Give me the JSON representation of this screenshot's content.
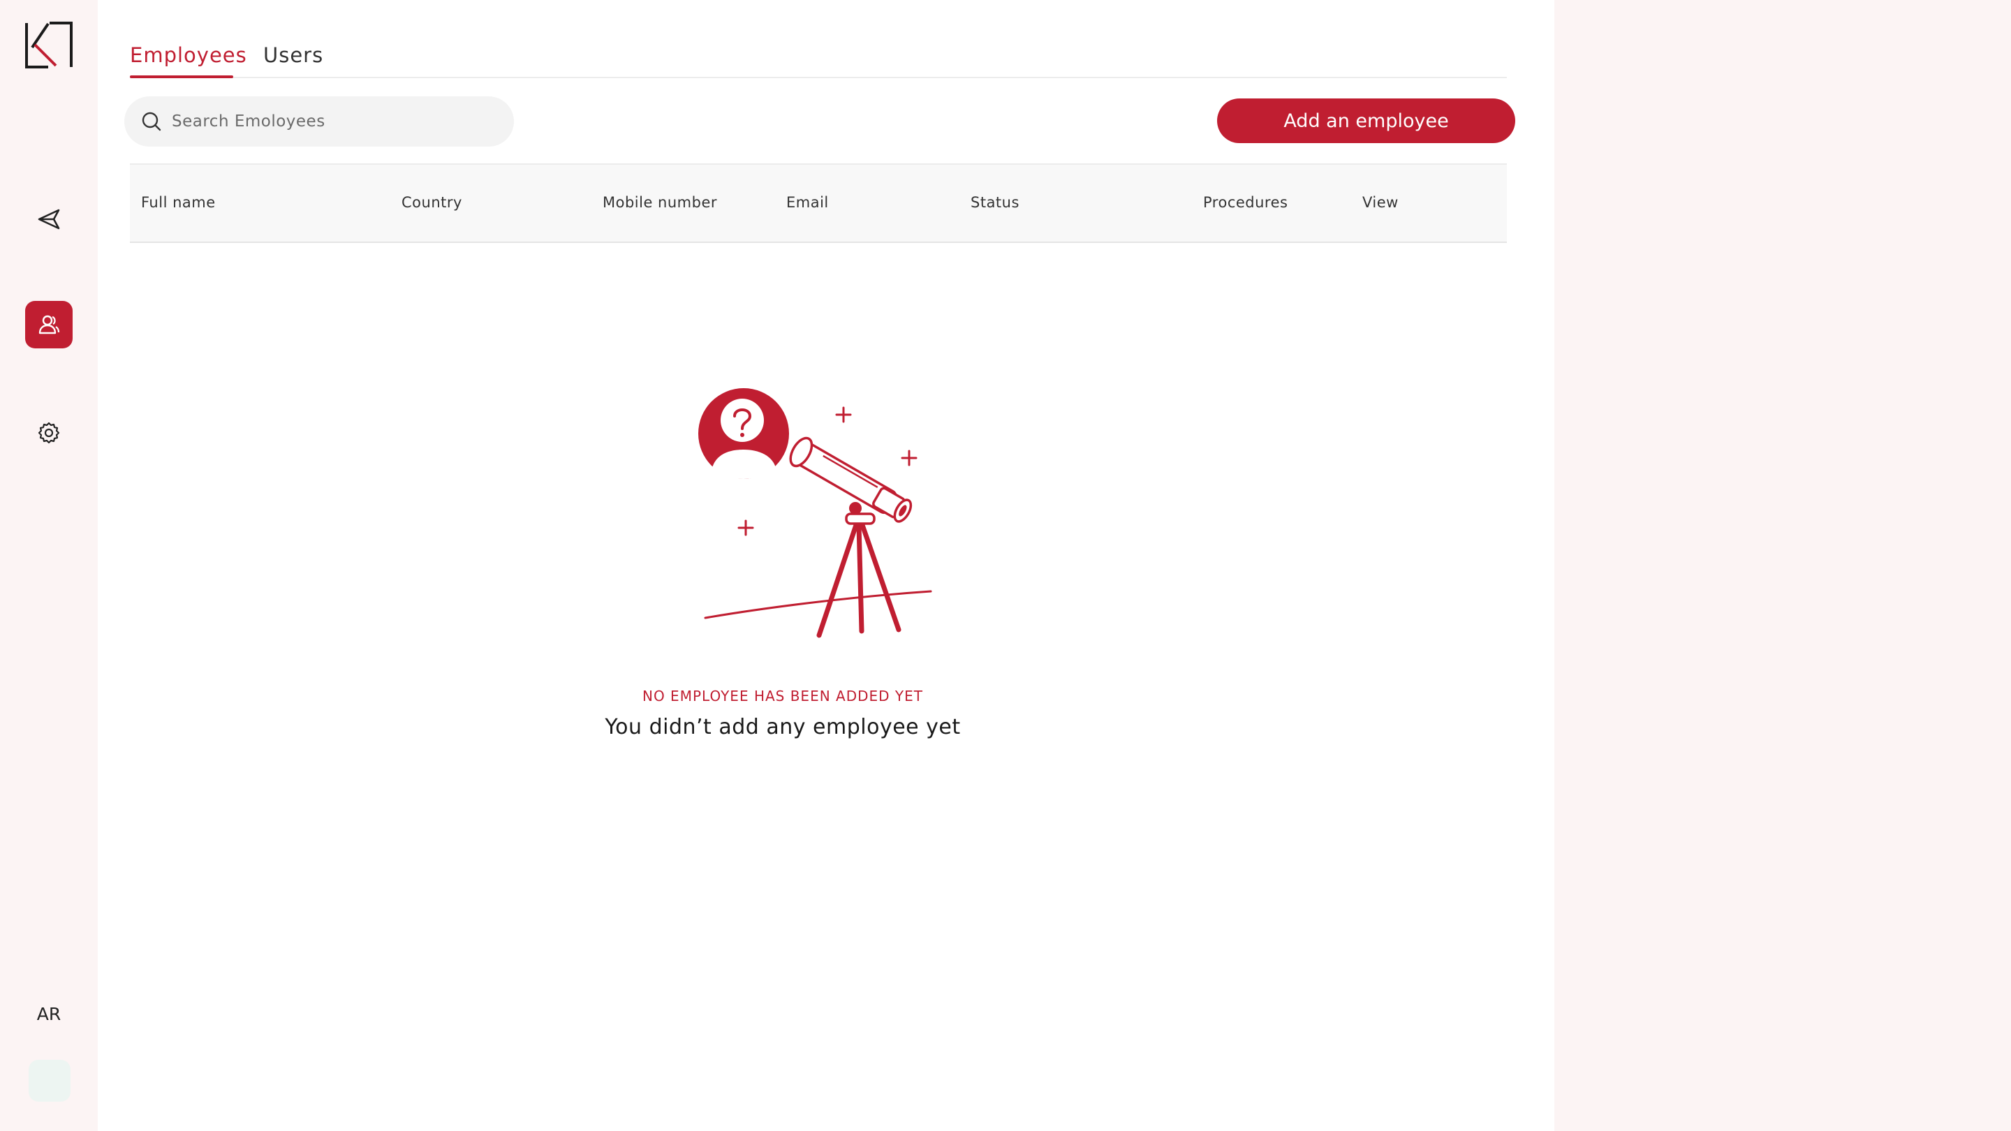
{
  "sidebar": {
    "logo_icon": "brand-logo-icon",
    "nav": [
      {
        "name": "send-icon",
        "active": false
      },
      {
        "name": "users-icon",
        "active": true
      },
      {
        "name": "gear-icon",
        "active": false
      }
    ],
    "language": "AR"
  },
  "tabs": [
    {
      "label": "Employees",
      "active": true
    },
    {
      "label": "Users",
      "active": false
    }
  ],
  "search": {
    "placeholder": "Search Emoloyees",
    "value": ""
  },
  "actions": {
    "add_label": "Add an employee"
  },
  "table": {
    "columns": [
      "Full name",
      "Country",
      "Mobile number",
      "Email",
      "Status",
      "Procedures",
      "View"
    ],
    "rows": []
  },
  "empty_state": {
    "caption": "NO EMPLOYEE HAS BEEN ADDED YET",
    "title": "You didn’t add any employee yet",
    "illustration": "telescope-illustration"
  },
  "colors": {
    "accent": "#c01e31",
    "sidebar_bg": "#fcf4f4",
    "content_bg": "#ffffff"
  }
}
